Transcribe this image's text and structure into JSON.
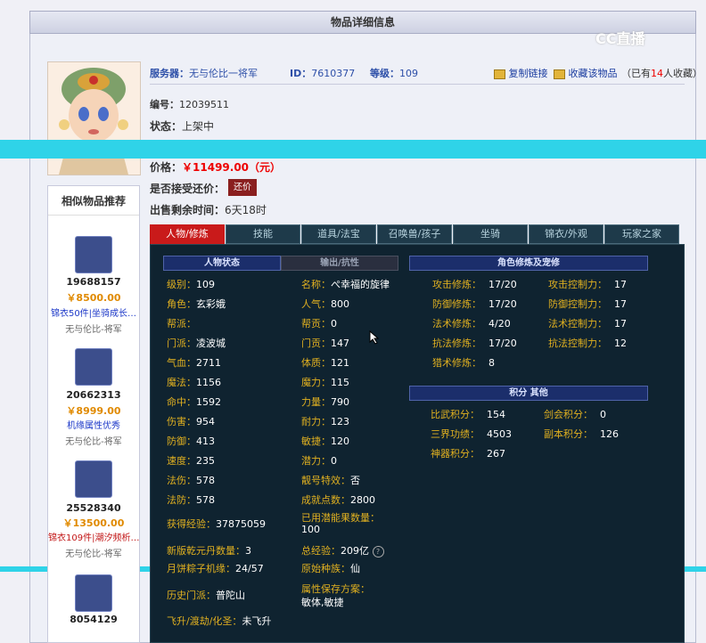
{
  "page_title": "物品详细信息",
  "watermark": "CC直播",
  "header": {
    "server_label": "服务器：",
    "server_value": "无与伦比一将军",
    "id_label": "ID：",
    "id_value": "7610377",
    "level_label": "等级：",
    "level_value": "109",
    "copy_link": "复制链接",
    "favorite": "收藏该物品",
    "fav_prefix": "（已有",
    "fav_count": "14",
    "fav_suffix": "人收藏）"
  },
  "details": {
    "code_label": "编号：",
    "code_value": "12039511",
    "status_label": "状态：",
    "status_value": "上架中",
    "price_label": "价格：",
    "price_value": "￥11499.00（元）",
    "bargain_label": "是否接受还价：",
    "bargain_button": "还价",
    "time_label": "出售剩余时间：",
    "time_value": "6天18时"
  },
  "tabs": [
    "人物/修炼",
    "技能",
    "道具/法宝",
    "召唤兽/孩子",
    "坐骑",
    "锦衣/外观",
    "玩家之家"
  ],
  "sections": {
    "char_state": "人物状态",
    "output": "输出/抗性",
    "cultivation": "角色修炼及宠修",
    "score": "积分 其他"
  },
  "left_stats": [
    {
      "k": "级别：",
      "v": "109"
    },
    {
      "k": "角色：",
      "v": "玄彩娥"
    },
    {
      "k": "帮派：",
      "v": ""
    },
    {
      "k": "门派：",
      "v": "凌波城"
    },
    {
      "k": "气血：",
      "v": "2711"
    },
    {
      "k": "魔法：",
      "v": "1156"
    },
    {
      "k": "命中：",
      "v": "1592"
    },
    {
      "k": "伤害：",
      "v": "954"
    },
    {
      "k": "防御：",
      "v": "413"
    },
    {
      "k": "速度：",
      "v": "235"
    },
    {
      "k": "法伤：",
      "v": "578"
    },
    {
      "k": "法防：",
      "v": "578"
    }
  ],
  "mid_stats": [
    {
      "k": "名称：",
      "v": "ぺ幸福的旋律"
    },
    {
      "k": "人气：",
      "v": "800"
    },
    {
      "k": "帮贡：",
      "v": "0"
    },
    {
      "k": "门贡：",
      "v": "147"
    },
    {
      "k": "体质：",
      "v": "121"
    },
    {
      "k": "魔力：",
      "v": "115"
    },
    {
      "k": "力量：",
      "v": "790"
    },
    {
      "k": "耐力：",
      "v": "123"
    },
    {
      "k": "敏捷：",
      "v": "120"
    },
    {
      "k": "潜力：",
      "v": "0"
    },
    {
      "k": "靓号特效：",
      "v": "否"
    },
    {
      "k": "成就点数：",
      "v": "2800"
    }
  ],
  "lower_stats": {
    "exp_label": "获得经验：",
    "exp_value": "37875059",
    "used_label": "已用潜能果数量：",
    "used_value": "100",
    "qky_label": "新版乾元丹数量：",
    "qky_value": "3",
    "total_label": "总经验：",
    "total_value": "209亿",
    "zongzi_label": "月饼粽子机缘：",
    "zongzi_value": "24/57",
    "race_label": "原始种族：",
    "race_value": "仙",
    "history_label": "历史门派：",
    "history_value": "普陀山",
    "attr_label": "属性保存方案：",
    "attr_value": "敏体,敏捷",
    "fly_label": "飞升/渡劫/化圣：",
    "fly_value": "未飞升"
  },
  "cultivation": [
    {
      "k1": "攻击修炼：",
      "v1": "17/20",
      "k2": "攻击控制力：",
      "v2": "17"
    },
    {
      "k1": "防御修炼：",
      "v1": "17/20",
      "k2": "防御控制力：",
      "v2": "17"
    },
    {
      "k1": "法术修炼：",
      "v1": "4/20",
      "k2": "法术控制力：",
      "v2": "17"
    },
    {
      "k1": "抗法修炼：",
      "v1": "17/20",
      "k2": "抗法控制力：",
      "v2": "12"
    },
    {
      "k1": "猎术修炼：",
      "v1": "8",
      "k2": "",
      "v2": ""
    }
  ],
  "scores": [
    {
      "k1": "比武积分：",
      "v1": "154",
      "k2": "剑会积分：",
      "v2": "0"
    },
    {
      "k1": "三界功绩：",
      "v1": "4503",
      "k2": "副本积分：",
      "v2": "126"
    },
    {
      "k1": "神器积分：",
      "v1": "267",
      "k2": "",
      "v2": ""
    }
  ],
  "sidebar": {
    "title": "相似物品推荐",
    "items": [
      {
        "id": "19688157",
        "price": "￥8500.00",
        "desc": "锦衣50件|坐骑成长…",
        "server": "无与伦比-将军"
      },
      {
        "id": "20662313",
        "price": "￥8999.00",
        "desc": "机缘属性优秀",
        "server": "无与伦比-将军"
      },
      {
        "id": "25528340",
        "price": "￥13500.00",
        "desc": "锦衣109件|潮汐频析…",
        "server": "无与伦比-将军"
      },
      {
        "id": "8054129",
        "price": "",
        "desc": "",
        "server": ""
      }
    ]
  },
  "colors": {
    "accent_red": "#c91a1a",
    "panel_dark": "#0f2330",
    "label_gold": "#e0b020",
    "cyan_band": "#2fd3e8"
  }
}
